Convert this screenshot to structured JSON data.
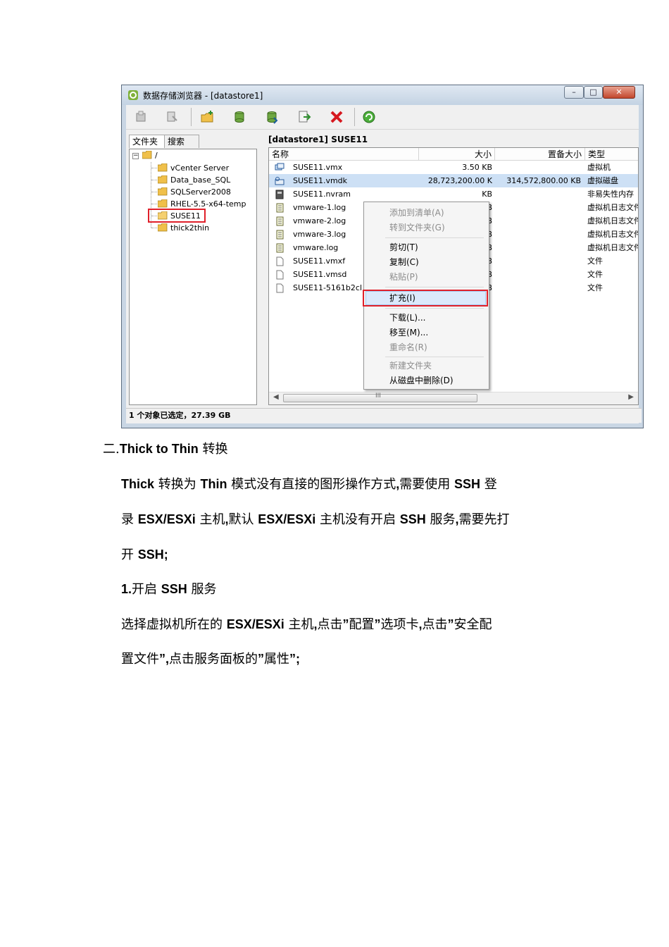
{
  "window": {
    "title": "数据存储浏览器 - [datastore1]",
    "min_glyph": "–",
    "max_glyph": "□",
    "close_glyph": "✕"
  },
  "toolbar": {
    "icons": [
      "upload-folder-icon",
      "download-icon",
      "new-folder-icon",
      "upload-file-icon",
      "download-file-icon",
      "move-icon",
      "delete-icon",
      "refresh-icon"
    ]
  },
  "left_tabs": [
    "文件夹",
    "搜索"
  ],
  "tree": {
    "root": "/",
    "children": [
      "vCenter Server",
      "Data_base_SQL",
      "SQLServer2008",
      "RHEL-5.5-x64-temp",
      "SUSE11",
      "thick2thin"
    ],
    "highlighted": "SUSE11"
  },
  "path_label": "[datastore1] SUSE11",
  "columns": [
    "名称",
    "大小",
    "置备大小",
    "类型"
  ],
  "files": [
    {
      "name": "SUSE11.vmx",
      "size": "3.50 KB",
      "provisioned": "",
      "type": "虚拟机",
      "icon": "vm-icon"
    },
    {
      "name": "SUSE11.vmdk",
      "size": "28,723,200.00 K",
      "provisioned": "314,572,800.00 KB",
      "type": "虚拟磁盘",
      "icon": "disk-icon"
    },
    {
      "name": "SUSE11.nvram",
      "size": "KB",
      "provisioned": "",
      "type": "非易失性内存",
      "icon": "nvram-icon"
    },
    {
      "name": "vmware-1.log",
      "size": "KB",
      "provisioned": "",
      "type": "虚拟机日志文件",
      "icon": "log-icon"
    },
    {
      "name": "vmware-2.log",
      "size": "KB",
      "provisioned": "",
      "type": "虚拟机日志文件",
      "icon": "log-icon"
    },
    {
      "name": "vmware-3.log",
      "size": "KB",
      "provisioned": "",
      "type": "虚拟机日志文件",
      "icon": "log-icon"
    },
    {
      "name": "vmware.log",
      "size": "KB",
      "provisioned": "",
      "type": "虚拟机日志文件",
      "icon": "log-icon"
    },
    {
      "name": "SUSE11.vmxf",
      "size": "KB",
      "provisioned": "",
      "type": "文件",
      "icon": "file-icon"
    },
    {
      "name": "SUSE11.vmsd",
      "size": "KB",
      "provisioned": "",
      "type": "文件",
      "icon": "file-icon"
    },
    {
      "name": "SUSE11-5161b2cl",
      "size": "KB",
      "provisioned": "",
      "type": "文件",
      "icon": "file-icon"
    }
  ],
  "context_menu": {
    "items": [
      {
        "label": "添加到清单(A)",
        "disabled": true
      },
      {
        "label": "转到文件夹(G)",
        "disabled": true
      },
      {
        "label": "剪切(T)",
        "disabled": false
      },
      {
        "label": "复制(C)",
        "disabled": false
      },
      {
        "label": "粘贴(P)",
        "disabled": true
      },
      {
        "label": "扩充(I)",
        "disabled": false,
        "highlighted": true
      },
      {
        "label": "下载(L)...",
        "disabled": false
      },
      {
        "label": "移至(M)...",
        "disabled": false
      },
      {
        "label": "重命名(R)",
        "disabled": true
      },
      {
        "label": "新建文件夹",
        "disabled": true
      },
      {
        "label": "从磁盘中删除(D)",
        "disabled": false
      }
    ]
  },
  "scroll_mid": "III",
  "status_text": "1 个对象已选定，27.39 GB",
  "document": {
    "heading": {
      "prefix": "二.",
      "bold": "Thick to Thin",
      "suffix": " 转换"
    },
    "p1": {
      "line1": [
        [
          "b",
          "Thick"
        ],
        [
          "t",
          " 转换为 "
        ],
        [
          "b",
          "Thin"
        ],
        [
          "t",
          " 模式没有直接的图形操作方式"
        ],
        [
          "b",
          ","
        ],
        [
          "t",
          "需要使用 "
        ],
        [
          "b",
          "SSH"
        ],
        [
          "t",
          " 登"
        ]
      ],
      "line2": [
        [
          "t",
          "录 "
        ],
        [
          "b",
          "ESX/ESXi"
        ],
        [
          "t",
          " 主机"
        ],
        [
          "b",
          ","
        ],
        [
          "t",
          "默认 "
        ],
        [
          "b",
          "ESX/ESXi"
        ],
        [
          "t",
          " 主机没有开启 "
        ],
        [
          "b",
          "SSH"
        ],
        [
          "t",
          " 服务"
        ],
        [
          "b",
          ","
        ],
        [
          "t",
          "需要先打"
        ]
      ],
      "line3": [
        [
          "t",
          "开 "
        ],
        [
          "b",
          "SSH;"
        ]
      ]
    },
    "step1": [
      [
        "b",
        "1."
      ],
      [
        "t",
        "开启 "
      ],
      [
        "b",
        "SSH"
      ],
      [
        "t",
        " 服务"
      ]
    ],
    "p2": {
      "line1": [
        [
          "t",
          "选择虚拟机所在的 "
        ],
        [
          "b",
          "ESX/ESXi"
        ],
        [
          "t",
          " 主机"
        ],
        [
          "b",
          ","
        ],
        [
          "t",
          "点击"
        ],
        [
          "b",
          "”"
        ],
        [
          "t",
          "配置"
        ],
        [
          "b",
          "”"
        ],
        [
          "t",
          "选项卡"
        ],
        [
          "b",
          ","
        ],
        [
          "t",
          "点击"
        ],
        [
          "b",
          "”"
        ],
        [
          "t",
          "安全配"
        ]
      ],
      "line2": [
        [
          "t",
          "置文件"
        ],
        [
          "b",
          "”,"
        ],
        [
          "t",
          "点击服务面板的"
        ],
        [
          "b",
          "”"
        ],
        [
          "t",
          "属性"
        ],
        [
          "b",
          "”;"
        ]
      ]
    },
    "colors": {
      "red_highlight": "#e0202a",
      "selection": "#cde0f5"
    }
  }
}
